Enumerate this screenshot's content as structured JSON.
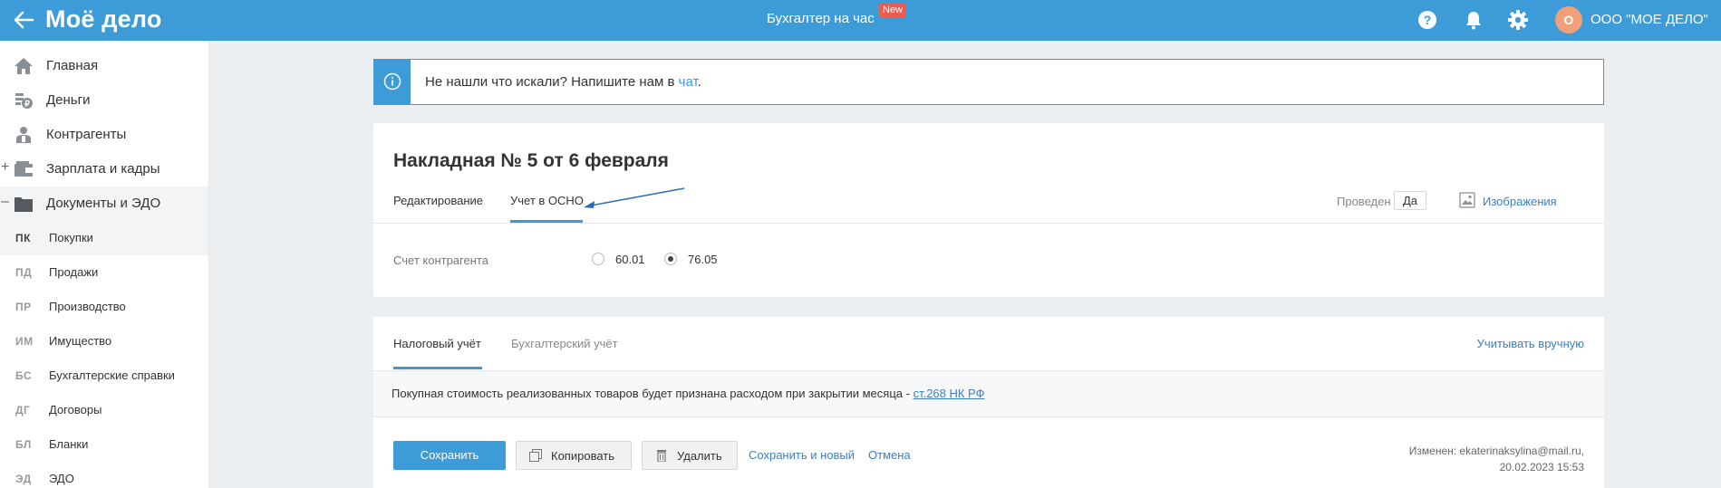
{
  "header": {
    "logo": "Моё дело",
    "center_link": "Бухгалтер на час",
    "new_badge": "New",
    "avatar_letter": "О",
    "org_name": "ООО \"МОЕ ДЕЛО\"",
    "icons": [
      "back-arrow-icon",
      "help-icon",
      "bell-icon",
      "gear-icon"
    ]
  },
  "sidebar": {
    "items": [
      {
        "label": "Главная",
        "icon": "home-icon"
      },
      {
        "label": "Деньги",
        "icon": "money-icon"
      },
      {
        "label": "Контрагенты",
        "icon": "contractors-icon"
      },
      {
        "label": "Зарплата и кадры",
        "icon": "wallet-icon",
        "sign": "+"
      },
      {
        "label": "Документы и ЭДО",
        "icon": "folder-icon",
        "sign": "–"
      }
    ],
    "subitems": [
      {
        "abbr": "ПК",
        "label": "Покупки"
      },
      {
        "abbr": "ПД",
        "label": "Продажи"
      },
      {
        "abbr": "ПР",
        "label": "Производство"
      },
      {
        "abbr": "ИМ",
        "label": "Имущество"
      },
      {
        "abbr": "БС",
        "label": "Бухгалтерские справки"
      },
      {
        "abbr": "ДГ",
        "label": "Договоры"
      },
      {
        "abbr": "БЛ",
        "label": "Бланки"
      },
      {
        "abbr": "ЭД",
        "label": "ЭДО"
      }
    ]
  },
  "alert": {
    "text": "Не нашли что искали? Напишите нам в ",
    "link": "чат",
    "tail": "."
  },
  "document": {
    "title": "Накладная № 5 от 6 февраля",
    "tabs": [
      "Редактирование",
      "Учет в ОСНО"
    ],
    "provided_label": "Проведен",
    "provided_value": "Да",
    "images_label": "Изображения",
    "account_label": "Счет контрагента",
    "account_options": [
      "60.01",
      "76.05"
    ],
    "account_selected": "76.05"
  },
  "accounting": {
    "tabs": [
      "Налоговый учёт",
      "Бухгалтерский учёт"
    ],
    "manual_link": "Учитывать вручную",
    "info_text": "Покупная стоимость реализованных товаров будет признана расходом при закрытии месяца - ",
    "info_link": "ст.268 НК РФ"
  },
  "actions": {
    "save": "Сохранить",
    "copy": "Копировать",
    "delete": "Удалить",
    "save_new": "Сохранить и новый",
    "cancel": "Отмена",
    "changed_line1": "Изменен: ekaterinaksylina@mail.ru,",
    "changed_line2": "20.02.2023 15:53"
  },
  "colors": {
    "accent": "#3d9bd8",
    "badge": "#ef5a4f",
    "avatar": "#f2a07a"
  }
}
